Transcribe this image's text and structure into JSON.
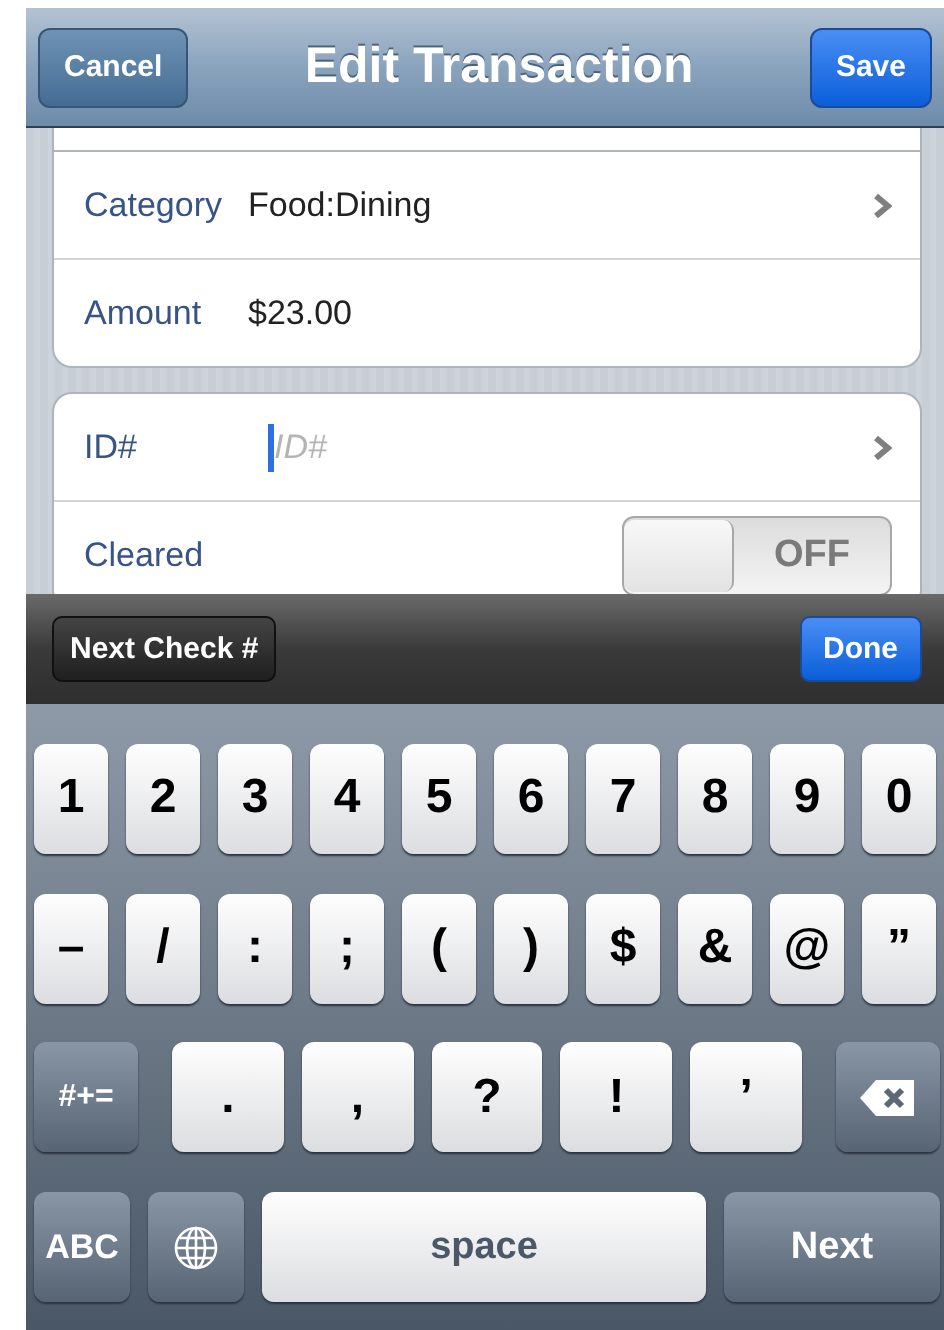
{
  "nav": {
    "cancel": "Cancel",
    "title": "Edit Transaction",
    "save": "Save"
  },
  "groups": [
    {
      "rows": [
        {
          "kind": "disclosure",
          "label": "Category",
          "value": "Food:Dining"
        },
        {
          "kind": "value",
          "label": "Amount",
          "value": "$23.00"
        }
      ]
    },
    {
      "rows": [
        {
          "kind": "input",
          "label": "ID#",
          "placeholder": "ID#"
        },
        {
          "kind": "switch",
          "label": "Cleared",
          "on": false,
          "switch_text": "OFF"
        }
      ]
    }
  ],
  "toolbar": {
    "left": "Next Check #",
    "right": "Done"
  },
  "keyboard": [
    [
      {
        "kind": "char",
        "text": "1"
      },
      {
        "kind": "char",
        "text": "2"
      },
      {
        "kind": "char",
        "text": "3"
      },
      {
        "kind": "char",
        "text": "4"
      },
      {
        "kind": "char",
        "text": "5"
      },
      {
        "kind": "char",
        "text": "6"
      },
      {
        "kind": "char",
        "text": "7"
      },
      {
        "kind": "char",
        "text": "8"
      },
      {
        "kind": "char",
        "text": "9"
      },
      {
        "kind": "char",
        "text": "0"
      }
    ],
    [
      {
        "kind": "char",
        "text": "–"
      },
      {
        "kind": "char",
        "text": "/"
      },
      {
        "kind": "char",
        "text": ":"
      },
      {
        "kind": "char",
        "text": ";"
      },
      {
        "kind": "char",
        "text": "("
      },
      {
        "kind": "char",
        "text": ")"
      },
      {
        "kind": "char",
        "text": "$"
      },
      {
        "kind": "char",
        "text": "&"
      },
      {
        "kind": "char",
        "text": "@"
      },
      {
        "kind": "char",
        "text": "”"
      }
    ],
    [
      {
        "kind": "func",
        "text": "#+="
      },
      {
        "kind": "wide",
        "text": "."
      },
      {
        "kind": "wide",
        "text": ","
      },
      {
        "kind": "wide",
        "text": "?"
      },
      {
        "kind": "wide",
        "text": "!"
      },
      {
        "kind": "wide",
        "text": "’"
      },
      {
        "kind": "backspace"
      }
    ],
    [
      {
        "kind": "func",
        "text": "ABC"
      },
      {
        "kind": "globe"
      },
      {
        "kind": "space",
        "text": "space"
      },
      {
        "kind": "next",
        "text": "Next"
      }
    ]
  ]
}
